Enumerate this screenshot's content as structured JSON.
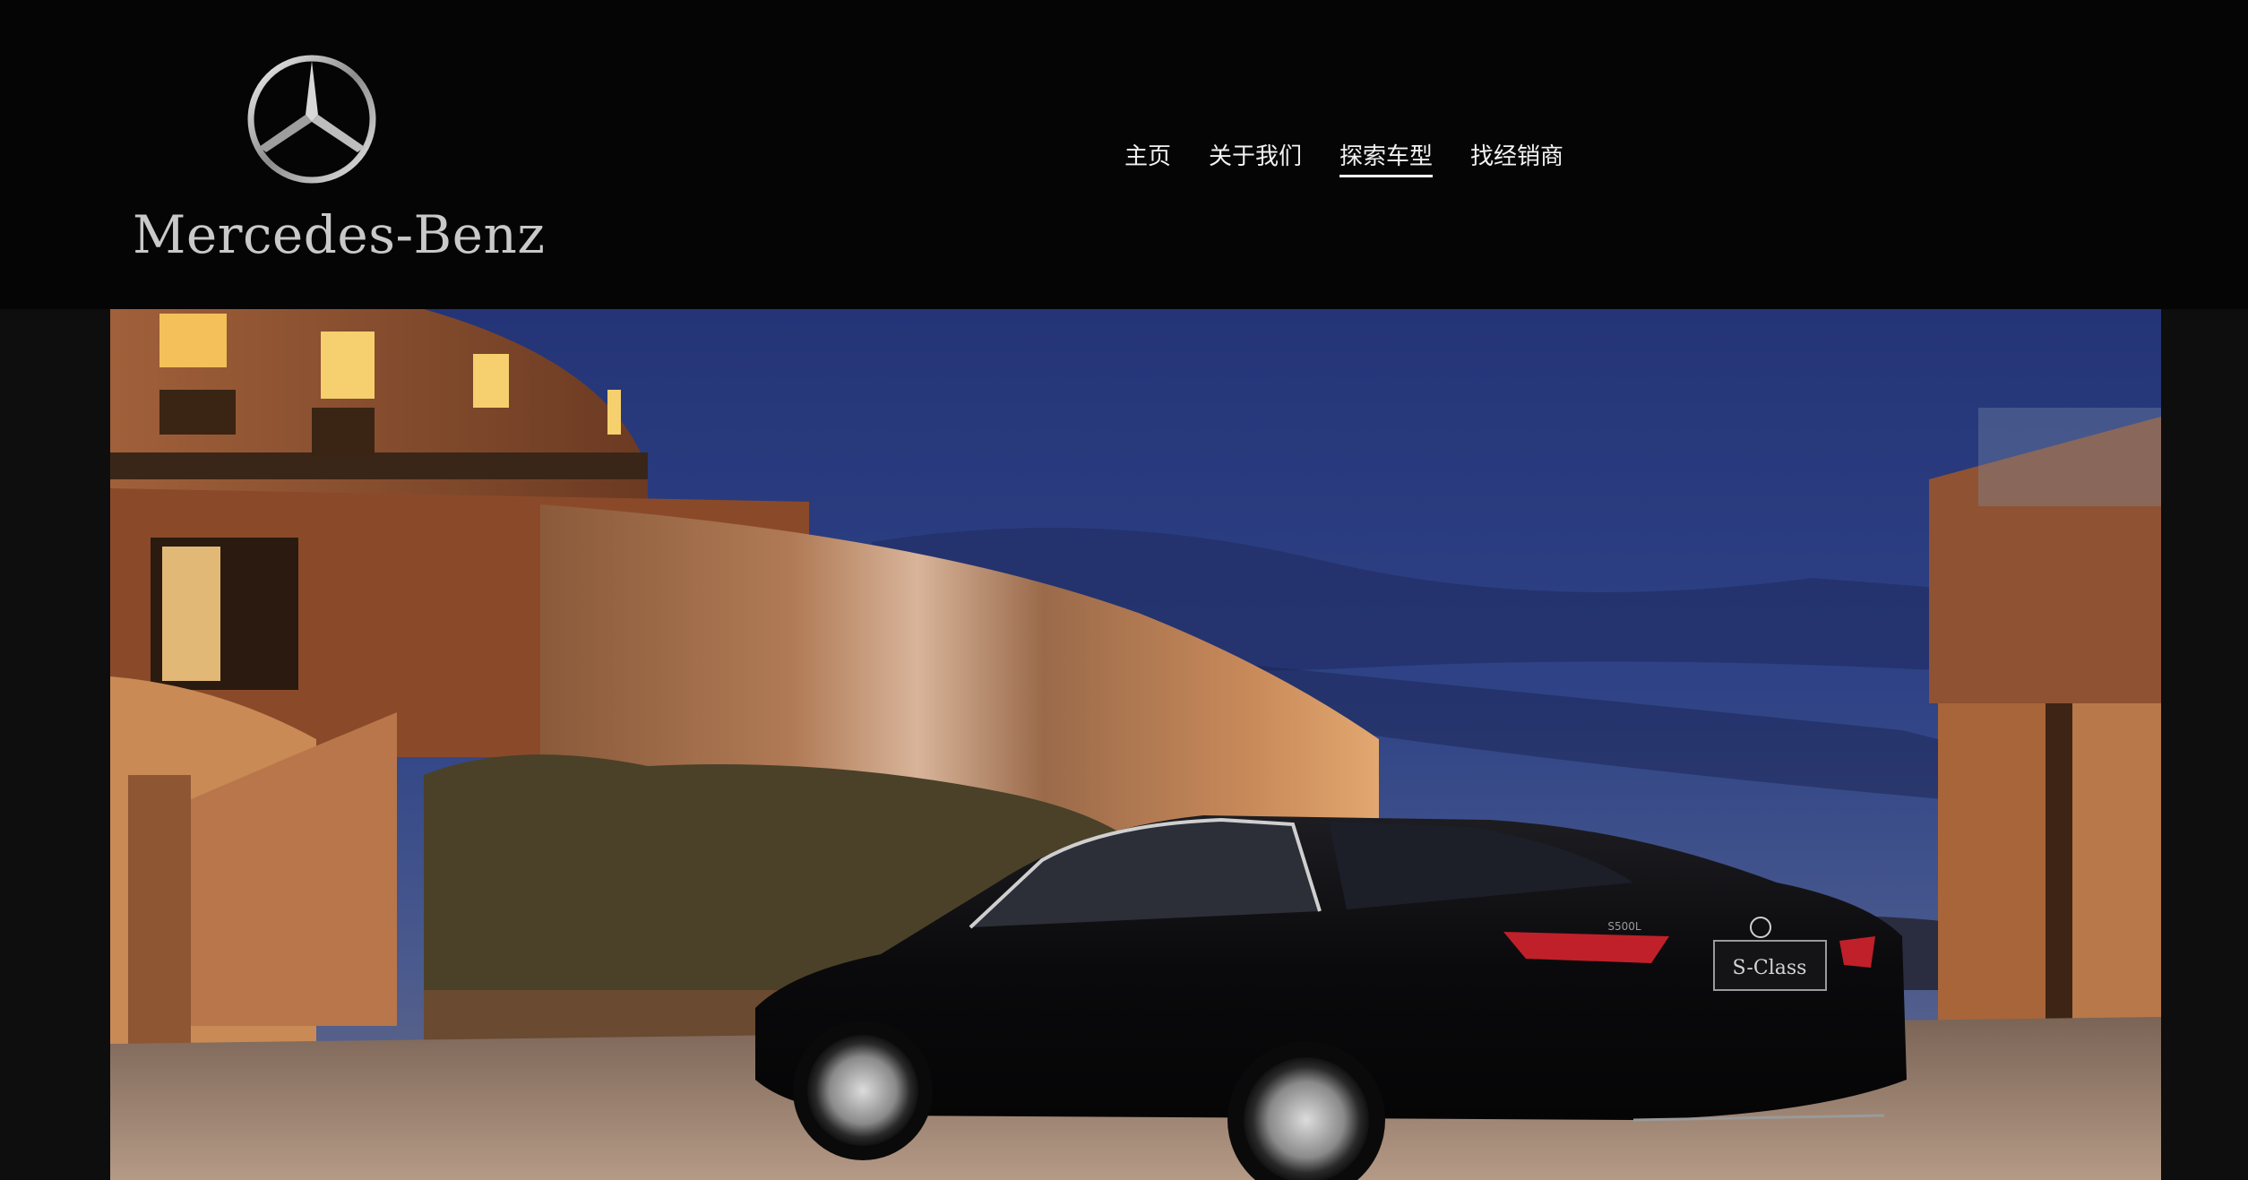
{
  "brand": {
    "wordmark": "Mercedes-Benz",
    "logo_icon": "three-pointed-star-icon"
  },
  "nav": {
    "items": [
      {
        "label": "主页"
      },
      {
        "label": "关于我们"
      },
      {
        "label": "探索车型",
        "active": true
      },
      {
        "label": "找经销商"
      }
    ]
  },
  "hero": {
    "badge_text": "S-Class",
    "trunk_text": "S500L",
    "colors": {
      "sky": "#2c3d7a",
      "building": "#8a4f2a",
      "car": "#0b0b0d"
    }
  }
}
